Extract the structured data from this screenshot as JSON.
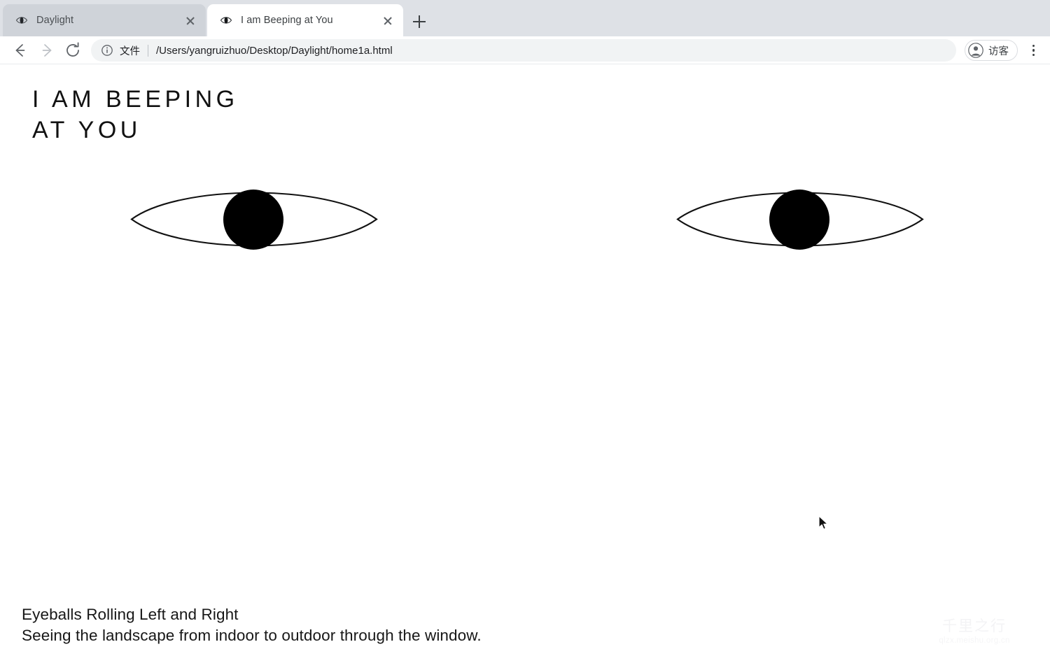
{
  "browser": {
    "tabs": [
      {
        "title": "Daylight",
        "favicon": "eye-icon",
        "active": false,
        "close_label": "Close tab"
      },
      {
        "title": "I am Beeping at You",
        "favicon": "eye-icon",
        "active": true,
        "close_label": "Close tab"
      }
    ],
    "new_tab_label": "+",
    "toolbar": {
      "back_icon": "arrow-left-icon",
      "forward_icon": "arrow-right-icon",
      "reload_icon": "reload-icon",
      "omnibox": {
        "info_icon": "info-circle-icon",
        "scheme_label": "文件",
        "url": "/Users/yangruizhuo/Desktop/Daylight/home1a.html"
      },
      "profile": {
        "avatar_icon": "person-icon",
        "label": "访客"
      },
      "menu_icon": "kebab-menu-icon"
    }
  },
  "page": {
    "headline": "I AM BEEPING AT YOU",
    "eyes": [
      {
        "name": "left-eye",
        "pupil_position": "slightly-left-of-center"
      },
      {
        "name": "right-eye",
        "pupil_position": "slightly-left-of-center"
      }
    ],
    "caption": "Eyeballs Rolling Left and Right\nSeeing the landscape from indoor to outdoor through the window.",
    "watermark": {
      "mark": "千里之行",
      "url": "qlzx.meishu.org.cn"
    },
    "colors": {
      "ink": "#111111",
      "paper": "#ffffff",
      "tabstrip": "#dee1e6",
      "omnibox": "#f1f3f4"
    }
  }
}
